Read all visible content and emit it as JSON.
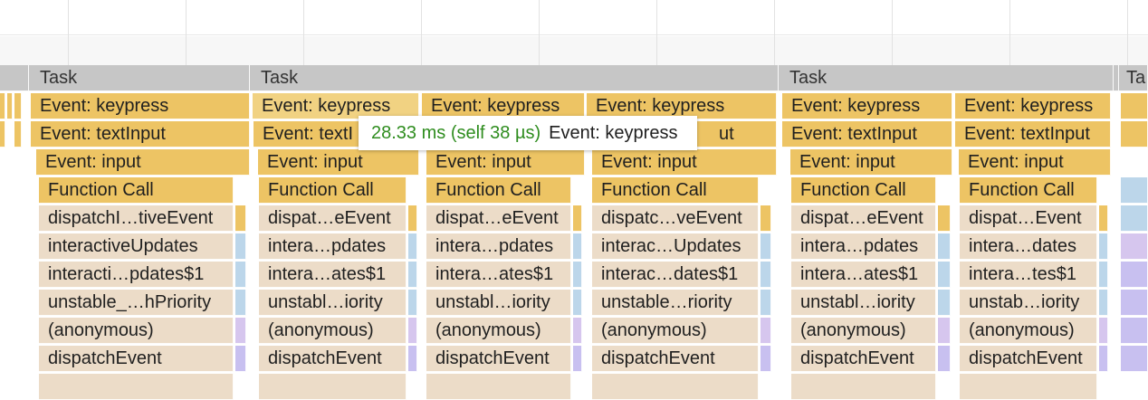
{
  "tooltip": {
    "time": "28.33 ms (self 38 µs)",
    "event": "Event: keypress"
  },
  "colors": {
    "task": "#c6c6c6",
    "scripting": "#edc464",
    "scripting_light": "#f1d282",
    "native": "#ecdcc8",
    "tooltip_time": "#2f8d1f"
  },
  "flame_columns": [
    {
      "task": "Task",
      "event": "Event: keypress",
      "text_input": "Event: textInput",
      "input": "Event: input",
      "function_call": "Function Call",
      "dispatch": "dispatchI…tiveEvent",
      "interactive_updates": "interactiveUpdates",
      "interactive_updates1": "interacti…pdates$1",
      "unstable": "unstable_…hPriority",
      "anonymous": "(anonymous)",
      "dispatch_event": "dispatchEvent"
    },
    {
      "task": "Task",
      "event": "Event: keypress",
      "text_input": "Event: textI",
      "input": "Event: input",
      "function_call": "Function Call",
      "dispatch": "dispat…eEvent",
      "interactive_updates": "intera…pdates",
      "interactive_updates1": "intera…ates$1",
      "unstable": "unstabl…iority",
      "anonymous": "(anonymous)",
      "dispatch_event": "dispatchEvent"
    },
    {
      "event": "Event: keypress",
      "text_input": "",
      "input": "Event: input",
      "function_call": "Function Call",
      "dispatch": "dispat…eEvent",
      "interactive_updates": "intera…pdates",
      "interactive_updates1": "intera…ates$1",
      "unstable": "unstabl…iority",
      "anonymous": "(anonymous)",
      "dispatch_event": "dispatchEvent"
    },
    {
      "event": "Event: keypress",
      "text_input": "ut",
      "input": "Event: input",
      "function_call": "Function Call",
      "dispatch": "dispatc…veEvent",
      "interactive_updates": "interac…Updates",
      "interactive_updates1": "interac…dates$1",
      "unstable": "unstable…riority",
      "anonymous": "(anonymous)",
      "dispatch_event": "dispatchEvent"
    },
    {
      "task": "Task",
      "event": "Event: keypress",
      "text_input": "Event: textInput",
      "input": "Event: input",
      "function_call": "Function Call",
      "dispatch": "dispat…eEvent",
      "interactive_updates": "intera…pdates",
      "interactive_updates1": "intera…ates$1",
      "unstable": "unstabl…iority",
      "anonymous": "(anonymous)",
      "dispatch_event": "dispatchEvent"
    },
    {
      "event": "Event: keypress",
      "text_input": "Event: textInput",
      "input": "Event: input",
      "function_call": "Function Call",
      "dispatch": "dispat…Event",
      "interactive_updates": "intera…dates",
      "interactive_updates1": "intera…tes$1",
      "unstable": "unstab…iority",
      "anonymous": "(anonymous)",
      "dispatch_event": "dispatchEvent"
    },
    {
      "task": "Ta"
    }
  ]
}
